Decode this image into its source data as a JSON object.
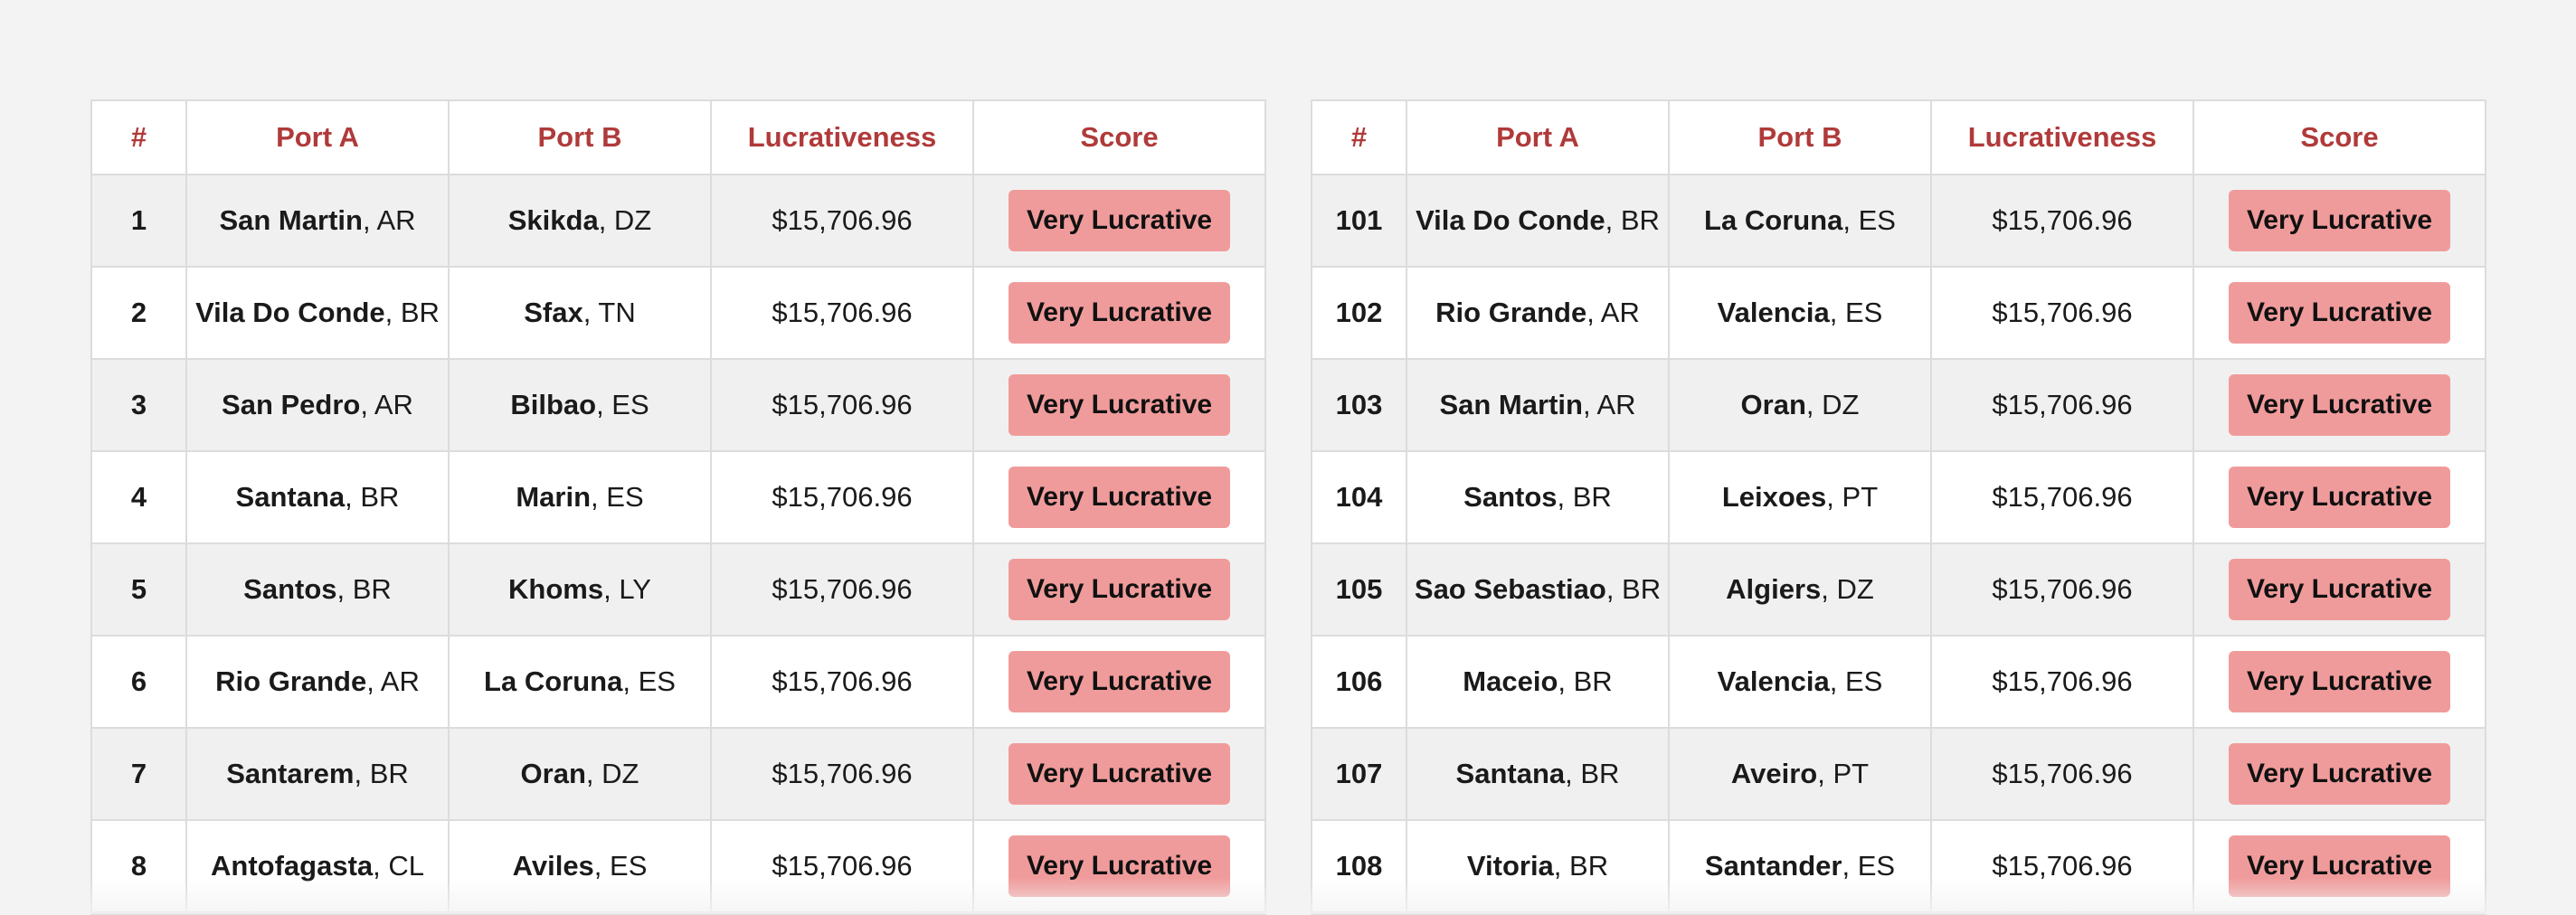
{
  "colors": {
    "page_background": "#f3f3f3",
    "header_text": "#b03a3a",
    "badge_background": "#f09b9b",
    "row_stripe": "#f0f0f0",
    "border": "#dcdcdc"
  },
  "columns": {
    "num": "#",
    "port_a": "Port A",
    "port_b": "Port B",
    "lucrativeness": "Lucrativeness",
    "score": "Score"
  },
  "tables": [
    {
      "rows": [
        {
          "num": "1",
          "port_a_name": "San Martin",
          "port_a_country": ", AR",
          "port_b_name": "Skikda",
          "port_b_country": ", DZ",
          "lucrativeness": "$15,706.96",
          "score": "Very Lucrative"
        },
        {
          "num": "2",
          "port_a_name": "Vila Do Conde",
          "port_a_country": ", BR",
          "port_b_name": "Sfax",
          "port_b_country": ", TN",
          "lucrativeness": "$15,706.96",
          "score": "Very Lucrative"
        },
        {
          "num": "3",
          "port_a_name": "San Pedro",
          "port_a_country": ", AR",
          "port_b_name": "Bilbao",
          "port_b_country": ", ES",
          "lucrativeness": "$15,706.96",
          "score": "Very Lucrative"
        },
        {
          "num": "4",
          "port_a_name": "Santana",
          "port_a_country": ", BR",
          "port_b_name": "Marin",
          "port_b_country": ", ES",
          "lucrativeness": "$15,706.96",
          "score": "Very Lucrative"
        },
        {
          "num": "5",
          "port_a_name": "Santos",
          "port_a_country": ", BR",
          "port_b_name": "Khoms",
          "port_b_country": ", LY",
          "lucrativeness": "$15,706.96",
          "score": "Very Lucrative"
        },
        {
          "num": "6",
          "port_a_name": "Rio Grande",
          "port_a_country": ", AR",
          "port_b_name": "La Coruna",
          "port_b_country": ", ES",
          "lucrativeness": "$15,706.96",
          "score": "Very Lucrative"
        },
        {
          "num": "7",
          "port_a_name": "Santarem",
          "port_a_country": ", BR",
          "port_b_name": "Oran",
          "port_b_country": ", DZ",
          "lucrativeness": "$15,706.96",
          "score": "Very Lucrative"
        },
        {
          "num": "8",
          "port_a_name": "Antofagasta",
          "port_a_country": ", CL",
          "port_b_name": "Aviles",
          "port_b_country": ", ES",
          "lucrativeness": "$15,706.96",
          "score": "Very Lucrative"
        }
      ]
    },
    {
      "rows": [
        {
          "num": "101",
          "port_a_name": "Vila Do Conde",
          "port_a_country": ", BR",
          "port_b_name": "La Coruna",
          "port_b_country": ", ES",
          "lucrativeness": "$15,706.96",
          "score": "Very Lucrative"
        },
        {
          "num": "102",
          "port_a_name": "Rio Grande",
          "port_a_country": ", AR",
          "port_b_name": "Valencia",
          "port_b_country": ", ES",
          "lucrativeness": "$15,706.96",
          "score": "Very Lucrative"
        },
        {
          "num": "103",
          "port_a_name": "San Martin",
          "port_a_country": ", AR",
          "port_b_name": "Oran",
          "port_b_country": ", DZ",
          "lucrativeness": "$15,706.96",
          "score": "Very Lucrative"
        },
        {
          "num": "104",
          "port_a_name": "Santos",
          "port_a_country": ", BR",
          "port_b_name": "Leixoes",
          "port_b_country": ", PT",
          "lucrativeness": "$15,706.96",
          "score": "Very Lucrative"
        },
        {
          "num": "105",
          "port_a_name": "Sao Sebastiao",
          "port_a_country": ", BR",
          "port_b_name": "Algiers",
          "port_b_country": ", DZ",
          "lucrativeness": "$15,706.96",
          "score": "Very Lucrative"
        },
        {
          "num": "106",
          "port_a_name": "Maceio",
          "port_a_country": ", BR",
          "port_b_name": "Valencia",
          "port_b_country": ", ES",
          "lucrativeness": "$15,706.96",
          "score": "Very Lucrative"
        },
        {
          "num": "107",
          "port_a_name": "Santana",
          "port_a_country": ", BR",
          "port_b_name": "Aveiro",
          "port_b_country": ", PT",
          "lucrativeness": "$15,706.96",
          "score": "Very Lucrative"
        },
        {
          "num": "108",
          "port_a_name": "Vitoria",
          "port_a_country": ", BR",
          "port_b_name": "Santander",
          "port_b_country": ", ES",
          "lucrativeness": "$15,706.96",
          "score": "Very Lucrative"
        }
      ]
    }
  ]
}
